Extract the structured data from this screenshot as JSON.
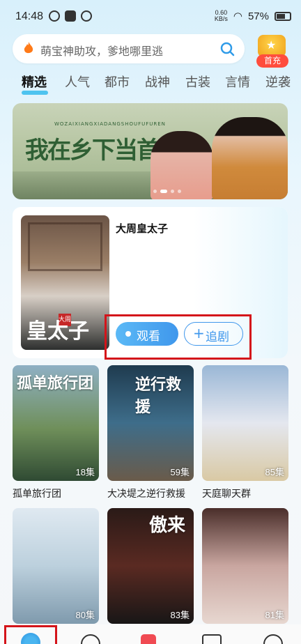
{
  "status_bar": {
    "time": "14:48",
    "net_speed_value": "0.60",
    "net_speed_unit": "KB/s",
    "battery": "57%"
  },
  "search": {
    "placeholder": "萌宝神助攻，爹地哪里逃"
  },
  "vip": {
    "label": "首充"
  },
  "tabs": [
    {
      "label": "精选",
      "active": true
    },
    {
      "label": "人气",
      "active": false
    },
    {
      "label": "都市",
      "active": false
    },
    {
      "label": "战神",
      "active": false
    },
    {
      "label": "古装",
      "active": false
    },
    {
      "label": "言情",
      "active": false
    },
    {
      "label": "逆袭",
      "active": false
    }
  ],
  "banner": {
    "title_art": "我在乡下当首富夫人",
    "pinyin": "WOZAIXIANGXIADANGSHOUFUFUREN",
    "slide_count": 4,
    "active_slide": 2
  },
  "featured": {
    "title": "大周皇太子",
    "poster_text": "皇太子",
    "poster_seal": "大周",
    "watch_label": "观看",
    "follow_label": "追剧"
  },
  "grid": [
    {
      "title": "孤单旅行团",
      "episodes": "18集",
      "art": "孤单旅行团",
      "colors": [
        "#8fb0c4",
        "#6f8f5a",
        "#2f4a33"
      ]
    },
    {
      "title": "大决堤之逆行救援",
      "episodes": "59集",
      "art": "逆行救援",
      "colors": [
        "#1f3b4f",
        "#3e6d8a",
        "#6a5b4a"
      ]
    },
    {
      "title": "天庭聊天群",
      "episodes": "85集",
      "art": "",
      "colors": [
        "#9ab7d6",
        "#e4e7ef",
        "#d9c9a4"
      ]
    },
    {
      "title": "",
      "episodes": "80集",
      "art": "",
      "colors": [
        "#dfe9f1",
        "#bcd0dd",
        "#7f9aad"
      ]
    },
    {
      "title": "",
      "episodes": "83集",
      "art": "傲来",
      "colors": [
        "#2a1a17",
        "#5a2a22",
        "#181616"
      ]
    },
    {
      "title": "",
      "episodes": "81集",
      "art": "",
      "colors": [
        "#4a2e2a",
        "#c9a6a0",
        "#e7d7d0"
      ]
    }
  ]
}
